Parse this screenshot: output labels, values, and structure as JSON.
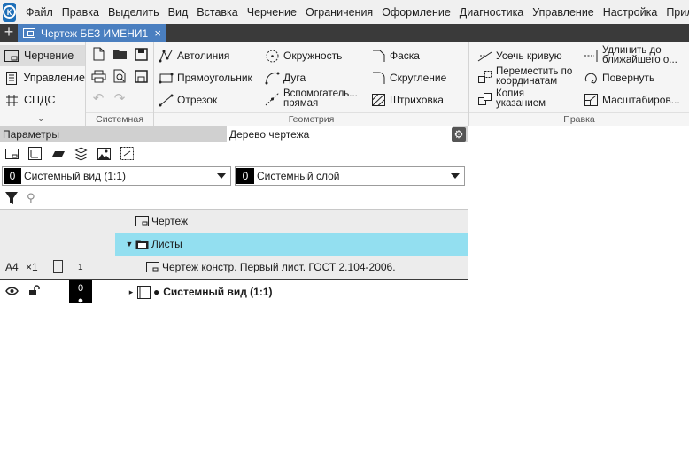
{
  "menu": [
    "Файл",
    "Правка",
    "Выделить",
    "Вид",
    "Вставка",
    "Черчение",
    "Ограничения",
    "Оформление",
    "Диагностика",
    "Управление",
    "Настройка",
    "Прило"
  ],
  "document_tab": {
    "title": "Чертеж БЕЗ ИМЕНИ1",
    "close": "×",
    "plus": "+"
  },
  "ribbon": {
    "modes": [
      {
        "label": "Черчение",
        "icon": "drawing-icon",
        "active": true
      },
      {
        "label": "Управление",
        "icon": "document-icon",
        "active": false
      },
      {
        "label": "СПДС",
        "icon": "grid-icon",
        "active": false
      }
    ],
    "sections": {
      "system": "Системная",
      "geometry": "Геометрия",
      "edit": "Правка"
    },
    "geometry_buttons": {
      "autoline": "Автолиния",
      "rectangle": "Прямоугольник",
      "segment": "Отрезок",
      "circle": "Окружность",
      "arc": "Дуга",
      "aux_line": "Вспомогатель... прямая",
      "chamfer": "Фаска",
      "fillet": "Скругление",
      "hatch": "Штриховка"
    },
    "edit_buttons": {
      "trim": "Усечь кривую",
      "move": "Переместить по координатам",
      "copy": "Копия указанием",
      "extend": "Удлинить до ближайшего о...",
      "rotate": "Повернуть",
      "scale": "Масштабиров..."
    }
  },
  "panel": {
    "tabs": [
      "Параметры",
      "Дерево чертежа"
    ],
    "view_select": {
      "num": "0",
      "value": "Системный вид (1:1)"
    },
    "layer_select": {
      "num": "0",
      "value": "Системный слой"
    },
    "search_placeholder": "",
    "tree": {
      "root": "Чертеж",
      "sheets": "Листы",
      "sheet_row": {
        "format": "A4",
        "mult": "×1",
        "count": "1",
        "label": "Чертеж констр. Первый лист. ГОСТ 2.104-2006."
      },
      "view_row": {
        "layer": "0",
        "label": "Системный вид (1:1)"
      }
    }
  },
  "colors": {
    "tab_active": "#4a7fc0",
    "tree_highlight": "#93dff0",
    "logo": "#1e6fb8"
  }
}
